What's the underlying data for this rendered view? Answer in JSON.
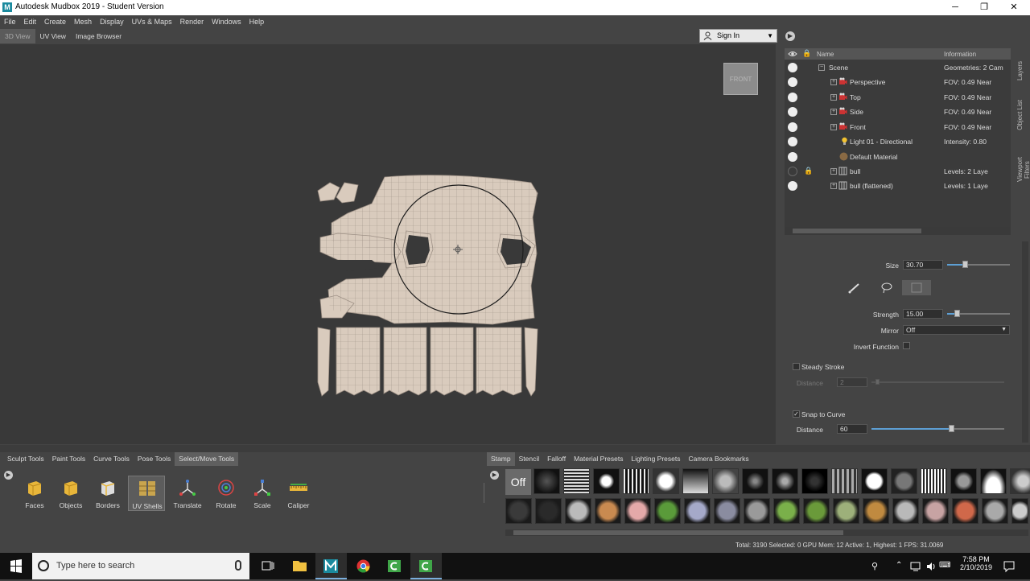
{
  "window": {
    "title": "Autodesk Mudbox 2019 - Student Version",
    "logo_letter": "M",
    "controls": [
      "─",
      "❐",
      "✕"
    ]
  },
  "menu": [
    "File",
    "Edit",
    "Create",
    "Mesh",
    "Display",
    "UVs & Maps",
    "Render",
    "Windows",
    "Help"
  ],
  "view_tabs": [
    "3D View",
    "UV View",
    "Image Browser"
  ],
  "sign_in": "Sign In",
  "viewport": {
    "cube_label": "FRONT"
  },
  "side_tabs": [
    "Layers",
    "Object List",
    "Viewport Filters"
  ],
  "object_list": {
    "headers": {
      "name": "Name",
      "info": "Information"
    },
    "rows": [
      {
        "name": "Scene",
        "info": "Geometries: 2   Cam"
      },
      {
        "name": "Perspective",
        "info": "FOV: 0.49       Near"
      },
      {
        "name": "Top",
        "info": "FOV: 0.49       Near"
      },
      {
        "name": "Side",
        "info": "FOV: 0.49       Near"
      },
      {
        "name": "Front",
        "info": "FOV: 0.49       Near"
      },
      {
        "name": "Light 01 - Directional",
        "info": "Intensity: 0.80"
      },
      {
        "name": "Default Material",
        "info": ""
      },
      {
        "name": "bull",
        "info": "Levels: 2        Laye"
      },
      {
        "name": "bull (flattened)",
        "info": "Levels: 1        Laye"
      }
    ]
  },
  "properties": {
    "size_label": "Size",
    "size_value": "30.70",
    "size_level": 0.28,
    "strength_label": "Strength",
    "strength_value": "15.00",
    "strength_level": 0.15,
    "mirror_label": "Mirror",
    "mirror_value": "Off",
    "invert_label": "Invert Function",
    "steady_label": "Steady Stroke",
    "distance1_label": "Distance",
    "distance1_value": "2",
    "snap_label": "Snap to Curve",
    "distance2_label": "Distance",
    "distance2_value": "60",
    "distance2_level": 0.6
  },
  "tool_tabs": [
    "Sculpt Tools",
    "Paint Tools",
    "Curve Tools",
    "Pose Tools",
    "Select/Move Tools"
  ],
  "tools": [
    "Faces",
    "Objects",
    "Borders",
    "UV Shells",
    "Translate",
    "Rotate",
    "Scale",
    "Caliper"
  ],
  "stamp_tabs": [
    "Stamp",
    "Stencil",
    "Falloff",
    "Material Presets",
    "Lighting Presets",
    "Camera Bookmarks"
  ],
  "stamp_off": "Off",
  "status": "Total: 3190  Selected: 0 GPU Mem: 12  Active: 1, Highest: 1 FPS: 31.0069",
  "taskbar": {
    "search_placeholder": "Type here to search",
    "time": "7:58 PM",
    "date": "2/10/2019"
  },
  "colors": {
    "accent": "#5d9fd4",
    "uv_mesh": "#d9cbbd",
    "viewport_bg": "#393939",
    "panel_bg": "#444444"
  }
}
